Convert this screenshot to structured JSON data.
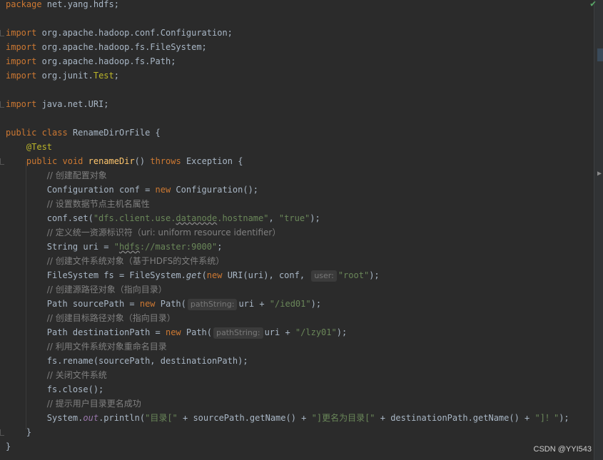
{
  "code": {
    "package_kw": "package",
    "package_name": " net.yang.hdfs;",
    "import_kw": "import",
    "imports": [
      " org.apache.hadoop.conf.Configuration;",
      " org.apache.hadoop.fs.FileSystem;",
      " org.apache.hadoop.fs.Path;",
      " org.junit.",
      " java.net.URI;"
    ],
    "junit_test": "Test",
    "semicolon": ";",
    "public_kw": "public",
    "class_kw": "class",
    "class_name": " RenameDirOrFile {",
    "annotation": "@Test",
    "void_kw": "void",
    "method_name": "renameDir",
    "method_parens": "() ",
    "throws_kw": "throws",
    "exception": " Exception {",
    "comments": [
      "// 创建配置对象",
      "// 设置数据节点主机名属性",
      "// 定义统一资源标识符（uri: uniform resource identifier）",
      "// 创建文件系统对象（基于HDFS的文件系统）",
      "// 创建源路径对象（指向目录）",
      "// 创建目标路径对象（指向目录）",
      "// 利用文件系统对象重命名目录",
      "// 关闭文件系统",
      "// 提示用户目录更名成功"
    ],
    "conf_decl": "Configuration conf = ",
    "new_kw": "new",
    "conf_ctor": " Configuration();",
    "conf_set": "conf.set(",
    "str_host_pre": "\"dfs.client.use.",
    "str_host_ul": "datanode",
    "str_host_post": ".hostname\"",
    "comma_sp": ", ",
    "str_true": "\"true\"",
    "close_paren_semi": ");",
    "uri_decl": "String uri = ",
    "str_uri_q": "\"",
    "str_uri_ul": "hdfs",
    "str_uri_post": "://master:9000\"",
    "fs_decl": "FileSystem fs = FileSystem.",
    "fs_get": "get",
    "fs_open": "(",
    "fs_uri": " URI(uri), conf, ",
    "hint_user": "user:",
    "str_root": "\"root\"",
    "src_decl": "Path sourcePath = ",
    "path_ctor": " Path(",
    "hint_path": "pathString:",
    "uri_plus": "uri + ",
    "str_ied": "\"/ied01\"",
    "dst_decl": "Path destinationPath = ",
    "str_lzy": "\"/lzy01\"",
    "rename_call": "fs.rename(sourcePath, destinationPath);",
    "close_call": "fs.close();",
    "sys": "System.",
    "out": "out",
    "println_open": ".println(",
    "str_msg1": "\"目录[\"",
    "msg_mid1": " + sourcePath.getName() + ",
    "str_msg2": "\"]更名为目录[\"",
    "msg_mid2": " + destinationPath.getName() + ",
    "str_msg3": "\"]！\"",
    "method_close": "}",
    "class_close": "}"
  },
  "watermark": "CSDN @YYI543",
  "icons": {
    "check": "check-icon",
    "arrow": "arrow-right-icon"
  }
}
